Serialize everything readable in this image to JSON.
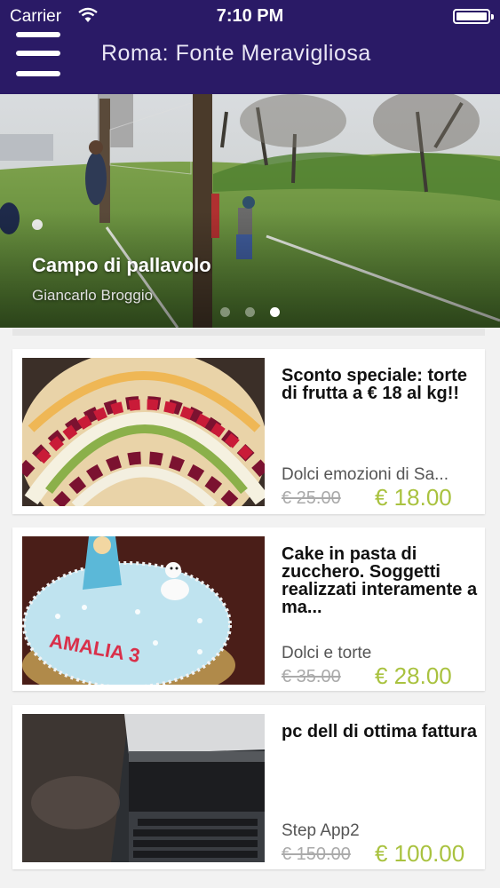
{
  "status_bar": {
    "carrier": "Carrier",
    "time": "7:10 PM"
  },
  "nav": {
    "title": "Roma: Fonte Meravigliosa",
    "menu_icon": "hamburger-menu-icon"
  },
  "hero": {
    "title": "Campo di pallavolo",
    "author": "Giancarlo Broggio",
    "page_count": 3,
    "active_page": 3
  },
  "items": [
    {
      "title": "Sconto speciale: torte di frutta a € 18 al kg!!",
      "seller": "Dolci emozioni di Sa...",
      "old_price": "€ 25.00",
      "price": "€ 18.00"
    },
    {
      "title": "Cake in pasta di zucchero. Soggetti realizzati interamente a ma...",
      "seller": "Dolci e torte",
      "old_price": "€ 35.00",
      "price": "€ 28.00",
      "image_text": "AMALIA 3"
    },
    {
      "title": "pc dell di ottima fattura",
      "seller": "Step App2",
      "old_price": "€ 150.00",
      "price": "€ 100.00"
    }
  ],
  "colors": {
    "nav_background": "#2a1a66",
    "price_green": "#a9c23f"
  }
}
